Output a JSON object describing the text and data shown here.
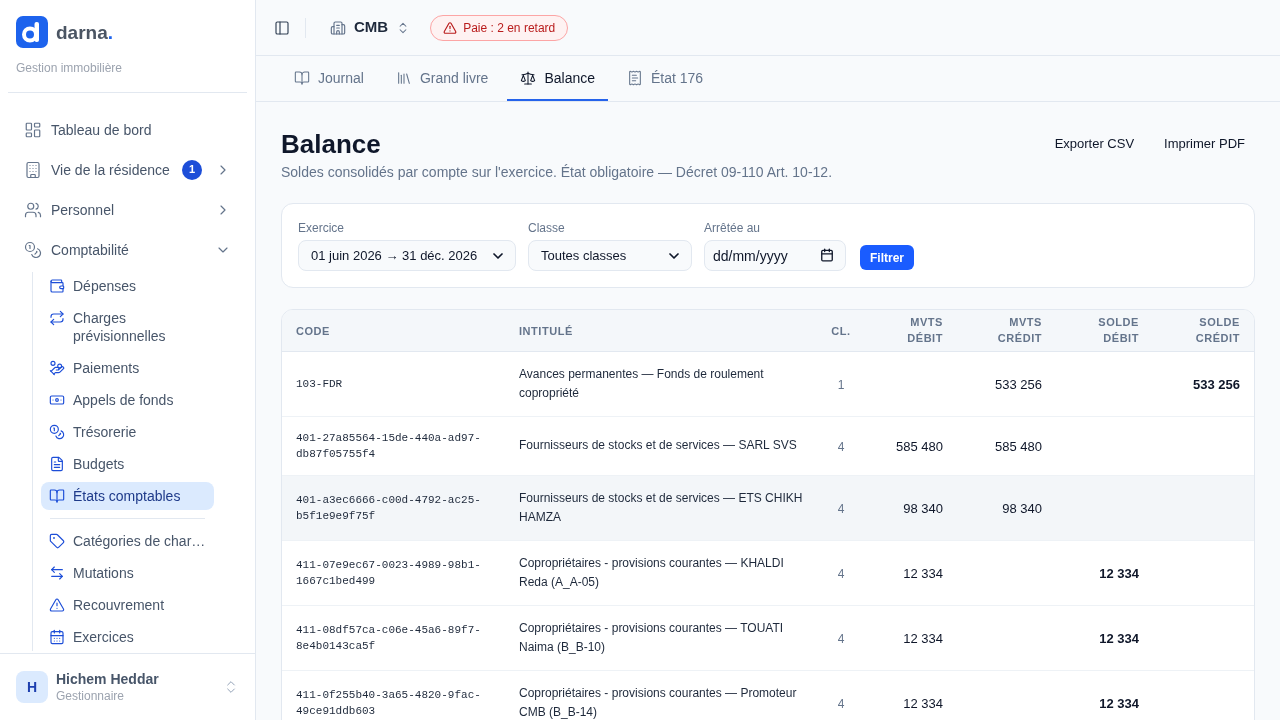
{
  "sidebar": {
    "brand": {
      "name": "darna",
      "dot": "."
    },
    "tagline": "Gestion immobilière",
    "items": [
      {
        "label": "Tableau de bord",
        "kind": "link",
        "selected": false
      },
      {
        "label": "Vie de la résidence",
        "kind": "group",
        "badge": "1",
        "expanded": false,
        "selected": false
      },
      {
        "label": "Personnel",
        "kind": "group",
        "expanded": false,
        "selected": false
      },
      {
        "label": "Comptabilité",
        "kind": "group",
        "expanded": true,
        "selected": false,
        "children": [
          {
            "label": "Dépenses",
            "selected": false,
            "divider_above": false
          },
          {
            "label": "Charges prévisionnelles",
            "selected": false,
            "divider_above": false
          },
          {
            "label": "Paiements",
            "selected": false,
            "divider_above": false
          },
          {
            "label": "Appels de fonds",
            "selected": false,
            "divider_above": false
          },
          {
            "label": "Trésorerie",
            "selected": false,
            "divider_above": false
          },
          {
            "label": "Budgets",
            "selected": false,
            "divider_above": false
          },
          {
            "label": "États comptables",
            "selected": true,
            "divider_above": false
          },
          {
            "label": "Catégories de char…",
            "selected": false,
            "divider_above": true
          },
          {
            "label": "Mutations",
            "selected": false,
            "divider_above": false
          },
          {
            "label": "Recouvrement",
            "selected": false,
            "divider_above": false
          },
          {
            "label": "Exercices",
            "selected": false,
            "divider_above": false
          }
        ]
      }
    ],
    "user": {
      "initial": "H",
      "name": "Hichem Heddar",
      "role": "Gestionnaire"
    }
  },
  "topbar": {
    "residence": "CMB",
    "alert": "Paie : 2 en retard"
  },
  "tabs": [
    {
      "label": "Journal",
      "selected": false
    },
    {
      "label": "Grand livre",
      "selected": false
    },
    {
      "label": "Balance",
      "selected": true
    },
    {
      "label": "État 176",
      "selected": false
    }
  ],
  "page": {
    "title": "Balance",
    "subtitle": "Soldes consolidés par compte sur l'exercice. État obligatoire — Décret 09-110 Art. 10-12.",
    "actions": [
      "Exporter CSV",
      "Imprimer PDF"
    ]
  },
  "filters": {
    "fields": [
      {
        "label": "Exercice",
        "kind": "select",
        "value": "01 juin 2026 → 31 déc. 2026"
      },
      {
        "label": "Classe",
        "kind": "select",
        "value": "Toutes classes"
      },
      {
        "label": "Arrêtée au",
        "kind": "date",
        "placeholder": "dd/mm/yyyy"
      }
    ],
    "submit": "Filtrer"
  },
  "table": {
    "columns": [
      "CODE",
      "INTITULÉ",
      "CL.",
      "MVTS DÉBIT",
      "MVTS CRÉDIT",
      "SOLDE DÉBIT",
      "SOLDE CRÉDIT"
    ],
    "rows": [
      {
        "code": "103-FDR",
        "label": "Avances permanentes — Fonds de roulement copropriété",
        "class": "1",
        "mvts_credit": "533 256",
        "solde_credit": "533 256",
        "highlighted": false
      },
      {
        "code": "401-27a85564-15de-440a-ad97-db87f05755f4",
        "label": "Fournisseurs de stocks et de services — SARL SVS",
        "class": "4",
        "mvts_debit": "585 480",
        "mvts_credit": "585 480",
        "highlighted": false
      },
      {
        "code": "401-a3ec6666-c00d-4792-ac25-b5f1e9e9f75f",
        "label": "Fournisseurs de stocks et de services — ETS CHIKH HAMZA",
        "class": "4",
        "mvts_debit": "98 340",
        "mvts_credit": "98 340",
        "highlighted": true
      },
      {
        "code": "411-07e9ec67-0023-4989-98b1-1667c1bed499",
        "label": "Copropriétaires - provisions courantes — KHALDI Reda (A_A-05)",
        "class": "4",
        "mvts_debit": "12 334",
        "solde_debit": "12 334",
        "highlighted": false
      },
      {
        "code": "411-08df57ca-c06e-45a6-89f7-8e4b0143ca5f",
        "label": "Copropriétaires - provisions courantes — TOUATI Naima (B_B-10)",
        "class": "4",
        "mvts_debit": "12 334",
        "solde_debit": "12 334",
        "highlighted": false
      },
      {
        "code": "411-0f255b40-3a65-4820-9fac-49ce91ddb603",
        "label": "Copropriétaires - provisions courantes — Promoteur CMB (B_B-14)",
        "class": "4",
        "mvts_debit": "12 334",
        "solde_debit": "12 334",
        "highlighted": false
      }
    ]
  }
}
